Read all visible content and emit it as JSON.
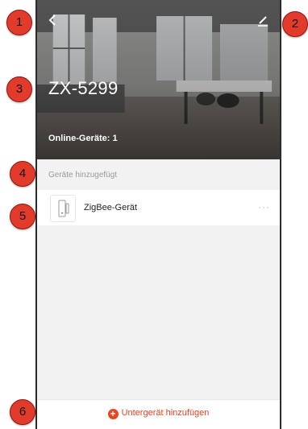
{
  "header": {
    "home_name": "ZX-5299",
    "online_label": "Online-Geräte: 1"
  },
  "devices_section": {
    "title": "Geräte hinzugefügt",
    "items": [
      {
        "name": "ZigBee-Gerät",
        "more": "···"
      }
    ]
  },
  "bottom": {
    "add_label": "Untergerät hinzufügen",
    "plus": "+"
  },
  "badges": [
    "1",
    "2",
    "3",
    "4",
    "5",
    "6"
  ],
  "colors": {
    "accent": "#e8441f",
    "badge": "#e23b2c",
    "background": "#f2f2f2"
  }
}
